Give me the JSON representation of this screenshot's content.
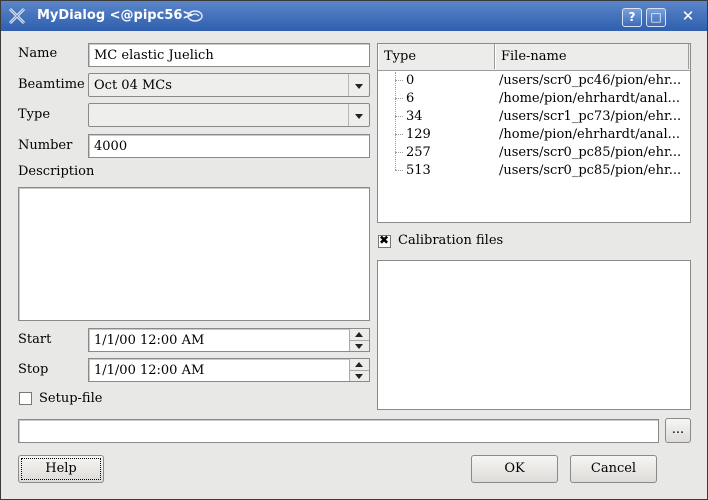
{
  "window": {
    "title": "MyDialog <@pipc56>",
    "buttons": {
      "help": "?",
      "maximize": "□",
      "close": "✕"
    }
  },
  "form": {
    "name": {
      "label": "Name",
      "value": "MC elastic Juelich"
    },
    "beamtime": {
      "label": "Beamtime",
      "value": "Oct 04 MCs"
    },
    "type": {
      "label": "Type",
      "value": ""
    },
    "number": {
      "label": "Number",
      "value": "4000"
    },
    "description": {
      "label": "Description",
      "value": ""
    },
    "start": {
      "label": "Start",
      "value": "1/1/00 12:00 AM"
    },
    "stop": {
      "label": "Stop",
      "value": "1/1/00 12:00 AM"
    },
    "setup_file": {
      "label": "Setup-file",
      "checked": false
    },
    "path": {
      "value": ""
    },
    "browse_label": "..."
  },
  "file_list": {
    "columns": [
      "Type",
      "File-name"
    ],
    "rows": [
      {
        "type": "0",
        "file": "/users/scr0_pc46/pion/ehr..."
      },
      {
        "type": "6",
        "file": "/home/pion/ehrhardt/anal..."
      },
      {
        "type": "34",
        "file": "/users/scr1_pc73/pion/ehr..."
      },
      {
        "type": "129",
        "file": "/home/pion/ehrhardt/anal..."
      },
      {
        "type": "257",
        "file": "/users/scr0_pc85/pion/ehr..."
      },
      {
        "type": "513",
        "file": "/users/scr0_pc85/pion/ehr..."
      }
    ]
  },
  "calibration": {
    "label": "Calibration files",
    "checked": true
  },
  "buttons": {
    "help": "Help",
    "ok": "OK",
    "cancel": "Cancel"
  },
  "colors": {
    "titlebar": "#3f6dbb",
    "background": "#e8e8e6"
  }
}
